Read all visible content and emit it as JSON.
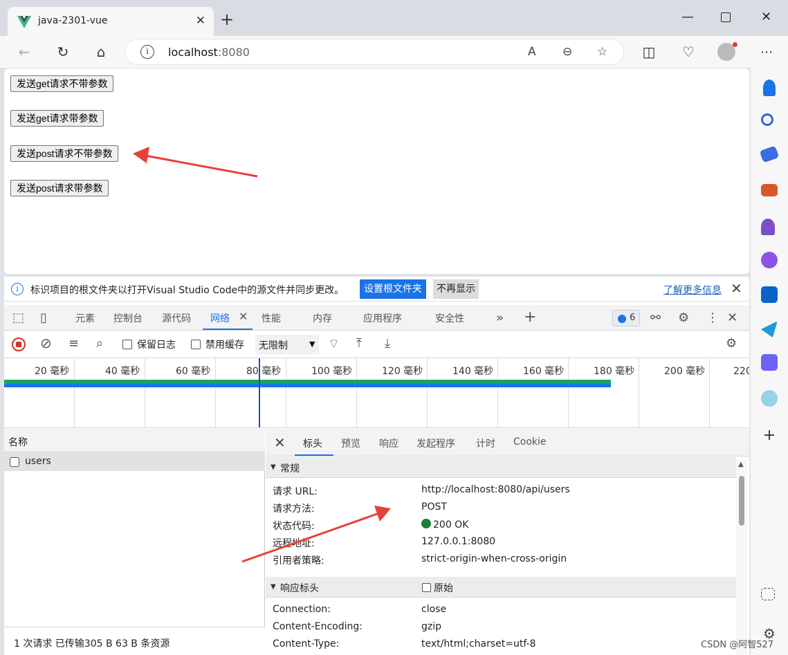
{
  "browser": {
    "tab_title": "java-2301-vue",
    "url_host": "localhost",
    "url_port": ":8080"
  },
  "page": {
    "buttons": [
      "发送get请求不带参数",
      "发送get请求带参数",
      "发送post请求不带参数",
      "发送post请求带参数"
    ]
  },
  "devtools": {
    "infobar": {
      "message": "标识项目的根文件夹以打开Visual Studio Code中的源文件并同步更改。",
      "primary": "设置根文件夹",
      "secondary": "不再显示",
      "learn_more": "了解更多信息"
    },
    "tabs": [
      "元素",
      "控制台",
      "源代码",
      "网络",
      "性能",
      "内存",
      "应用程序",
      "安全性"
    ],
    "issues_count": "6",
    "toolbar": {
      "preserve_log": "保留日志",
      "disable_cache": "禁用缓存",
      "throttle": "无限制"
    },
    "timeline_ticks": [
      "20 毫秒",
      "40 毫秒",
      "60 毫秒",
      "80 毫秒",
      "100 毫秒",
      "120 毫秒",
      "140 毫秒",
      "160 毫秒",
      "180 毫秒",
      "200 毫秒",
      "220 毫秒"
    ],
    "requests": {
      "header": "名称",
      "items": [
        "users"
      ],
      "footer": "1 次请求  已传输305 B  63 B 条资源"
    },
    "detail_tabs": [
      "标头",
      "预览",
      "响应",
      "发起程序",
      "计时",
      "Cookie"
    ],
    "general": {
      "title": "常规",
      "rows": [
        {
          "k": "请求 URL:",
          "v": "http://localhost:8080/api/users"
        },
        {
          "k": "请求方法:",
          "v": "POST"
        },
        {
          "k": "状态代码:",
          "v": "200 OK"
        },
        {
          "k": "远程地址:",
          "v": "127.0.0.1:8080"
        },
        {
          "k": "引用者策略:",
          "v": "strict-origin-when-cross-origin"
        }
      ]
    },
    "response_headers": {
      "title": "响应标头",
      "raw_label": "原始",
      "rows": [
        {
          "k": "Connection:",
          "v": "close"
        },
        {
          "k": "Content-Encoding:",
          "v": "gzip"
        },
        {
          "k": "Content-Type:",
          "v": "text/html;charset=utf-8"
        }
      ]
    }
  },
  "watermark": "CSDN @阿智527",
  "colors": {
    "accent": "#1a73e8",
    "arrow": "#e8413a",
    "status_ok": "#188038"
  }
}
